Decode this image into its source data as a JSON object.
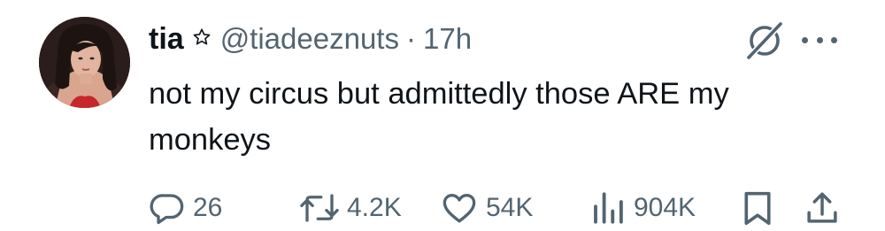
{
  "tweet": {
    "display_name": "tia",
    "verified_icon": "star-outline-icon",
    "handle": "@tiadeeznuts",
    "separator": "·",
    "time": "17h",
    "text": "not my circus but admittedly those ARE my monkeys"
  },
  "header_icons": {
    "grok": "grok-icon",
    "more": "more-options-icon"
  },
  "actions": {
    "replies": "26",
    "retweets": "4.2K",
    "likes": "54K",
    "views": "904K",
    "bookmark": "bookmark-icon",
    "share": "share-icon"
  },
  "colors": {
    "text_primary": "#0f1419",
    "text_secondary": "#536471",
    "background": "#ffffff"
  }
}
